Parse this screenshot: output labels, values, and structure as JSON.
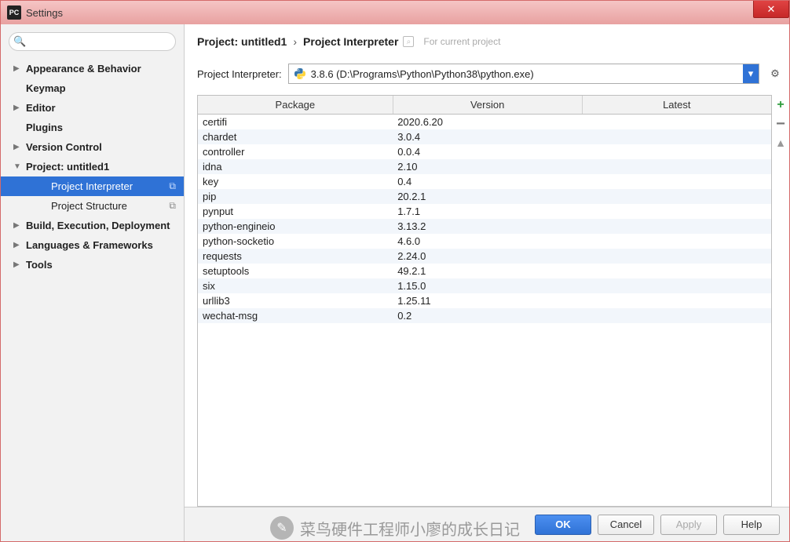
{
  "window": {
    "title": "Settings",
    "app_icon_text": "PC"
  },
  "sidebar": {
    "search_placeholder": "",
    "items": [
      {
        "label": "Appearance & Behavior",
        "bold": true,
        "expand": "right"
      },
      {
        "label": "Keymap",
        "bold": true,
        "expand": "none"
      },
      {
        "label": "Editor",
        "bold": true,
        "expand": "right"
      },
      {
        "label": "Plugins",
        "bold": true,
        "expand": "none"
      },
      {
        "label": "Version Control",
        "bold": true,
        "expand": "right"
      },
      {
        "label": "Project: untitled1",
        "bold": true,
        "expand": "down"
      },
      {
        "label": "Project Interpreter",
        "bold": false,
        "expand": "none",
        "child": true,
        "selected": true,
        "copy": true
      },
      {
        "label": "Project Structure",
        "bold": false,
        "expand": "none",
        "child": true,
        "copy": true
      },
      {
        "label": "Build, Execution, Deployment",
        "bold": true,
        "expand": "right"
      },
      {
        "label": "Languages & Frameworks",
        "bold": true,
        "expand": "right"
      },
      {
        "label": "Tools",
        "bold": true,
        "expand": "right"
      }
    ]
  },
  "breadcrumb": {
    "part1": "Project: untitled1",
    "part2": "Project Interpreter",
    "hint": "For current project"
  },
  "interpreter": {
    "label": "Project Interpreter:",
    "value": "3.8.6 (D:\\Programs\\Python\\Python38\\python.exe)"
  },
  "table": {
    "columns": [
      "Package",
      "Version",
      "Latest"
    ],
    "rows": [
      {
        "name": "certifi",
        "version": "2020.6.20",
        "latest": ""
      },
      {
        "name": "chardet",
        "version": "3.0.4",
        "latest": ""
      },
      {
        "name": "controller",
        "version": "0.0.4",
        "latest": ""
      },
      {
        "name": "idna",
        "version": "2.10",
        "latest": ""
      },
      {
        "name": "key",
        "version": "0.4",
        "latest": ""
      },
      {
        "name": "pip",
        "version": "20.2.1",
        "latest": ""
      },
      {
        "name": "pynput",
        "version": "1.7.1",
        "latest": ""
      },
      {
        "name": "python-engineio",
        "version": "3.13.2",
        "latest": ""
      },
      {
        "name": "python-socketio",
        "version": "4.6.0",
        "latest": ""
      },
      {
        "name": "requests",
        "version": "2.24.0",
        "latest": ""
      },
      {
        "name": "setuptools",
        "version": "49.2.1",
        "latest": ""
      },
      {
        "name": "six",
        "version": "1.15.0",
        "latest": ""
      },
      {
        "name": "urllib3",
        "version": "1.25.11",
        "latest": ""
      },
      {
        "name": "wechat-msg",
        "version": "0.2",
        "latest": ""
      }
    ]
  },
  "footer": {
    "ok": "OK",
    "cancel": "Cancel",
    "apply": "Apply",
    "help": "Help"
  },
  "watermark": {
    "text": "菜鸟硬件工程师小廖的成长日记"
  }
}
